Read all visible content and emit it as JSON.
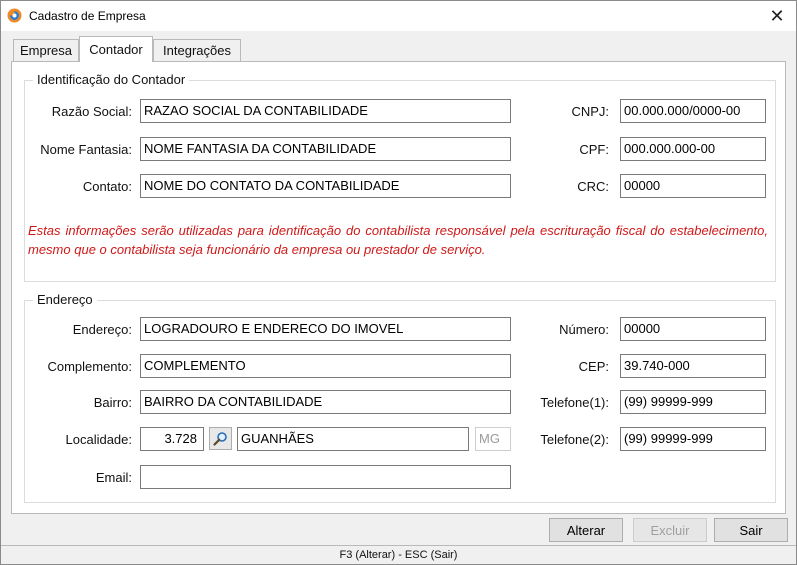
{
  "window": {
    "title": "Cadastro de Empresa",
    "close_label": "✕"
  },
  "tabs": [
    {
      "label": "Empresa",
      "active": false
    },
    {
      "label": "Contador",
      "active": true
    },
    {
      "label": "Integrações",
      "active": false
    }
  ],
  "identificacao": {
    "legend": "Identificação do Contador",
    "razao_social": {
      "label": "Razão Social:",
      "value": "RAZAO SOCIAL DA CONTABILIDADE"
    },
    "nome_fantasia": {
      "label": "Nome Fantasia:",
      "value": "NOME FANTASIA DA CONTABILIDADE"
    },
    "contato": {
      "label": "Contato:",
      "value": "NOME DO CONTATO DA CONTABILIDADE"
    },
    "cnpj": {
      "label": "CNPJ:",
      "value": "00.000.000/0000-00"
    },
    "cpf": {
      "label": "CPF:",
      "value": "000.000.000-00"
    },
    "crc": {
      "label": "CRC:",
      "value": "00000"
    },
    "note": "Estas informações serão utilizadas para identificação do contabilista responsável pela escrituração fiscal do estabelecimento, mesmo que o contabilista seja funcionário da empresa ou prestador de serviço."
  },
  "endereco": {
    "legend": "Endereço",
    "endereco": {
      "label": "Endereço:",
      "value": "LOGRADOURO E ENDERECO DO IMOVEL"
    },
    "complemento": {
      "label": "Complemento:",
      "value": "COMPLEMENTO"
    },
    "bairro": {
      "label": "Bairro:",
      "value": "BAIRRO DA CONTABILIDADE"
    },
    "localidade": {
      "label": "Localidade:",
      "code": "3.728",
      "city": "GUANHÃES",
      "uf": "MG"
    },
    "email": {
      "label": "Email:",
      "value": ""
    },
    "numero": {
      "label": "Número:",
      "value": "00000"
    },
    "cep": {
      "label": "CEP:",
      "value": "39.740-000"
    },
    "telefone1": {
      "label": "Telefone(1):",
      "value": "(99) 99999-999"
    },
    "telefone2": {
      "label": "Telefone(2):",
      "value": "(99) 99999-999"
    }
  },
  "buttons": {
    "alterar": "Alterar",
    "excluir": "Excluir",
    "sair": "Sair"
  },
  "status": "F3 (Alterar) - ESC (Sair)",
  "colors": {
    "note_text": "#d01818",
    "app_icon_orange": "#f08a24",
    "app_icon_blue": "#2a7fd4"
  },
  "icons": {
    "app": "app-logo-icon",
    "search": "magnifier-icon",
    "close": "close-icon"
  }
}
